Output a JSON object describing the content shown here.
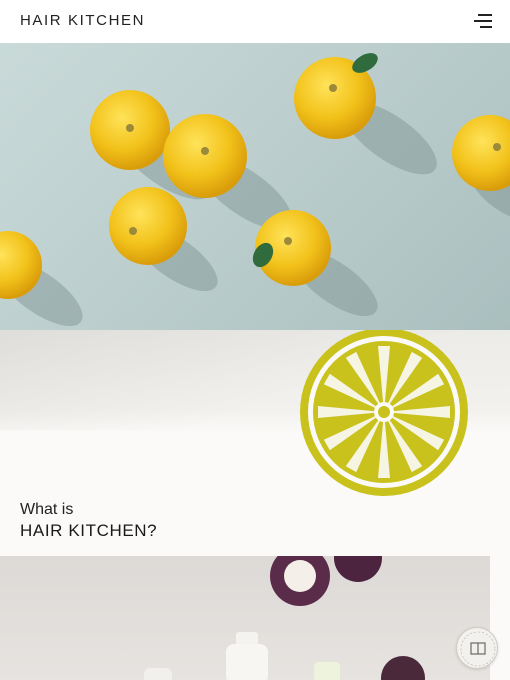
{
  "header": {
    "logo_text": "HAIR KITCHEN",
    "menu_icon": "hamburger-menu-icon"
  },
  "intro": {
    "line1": "What is",
    "line2": "HAIR KITCHEN?"
  },
  "badge": {
    "icon": "book-icon",
    "ring_text": "RECIPE · KITCHEN · RECIPE"
  },
  "colors": {
    "lemon_yellow": "#c9c21d",
    "citrus_yellow": "#f2c21a",
    "hero_background": "#bfd1d0",
    "text_dark": "#1f1f1f"
  }
}
